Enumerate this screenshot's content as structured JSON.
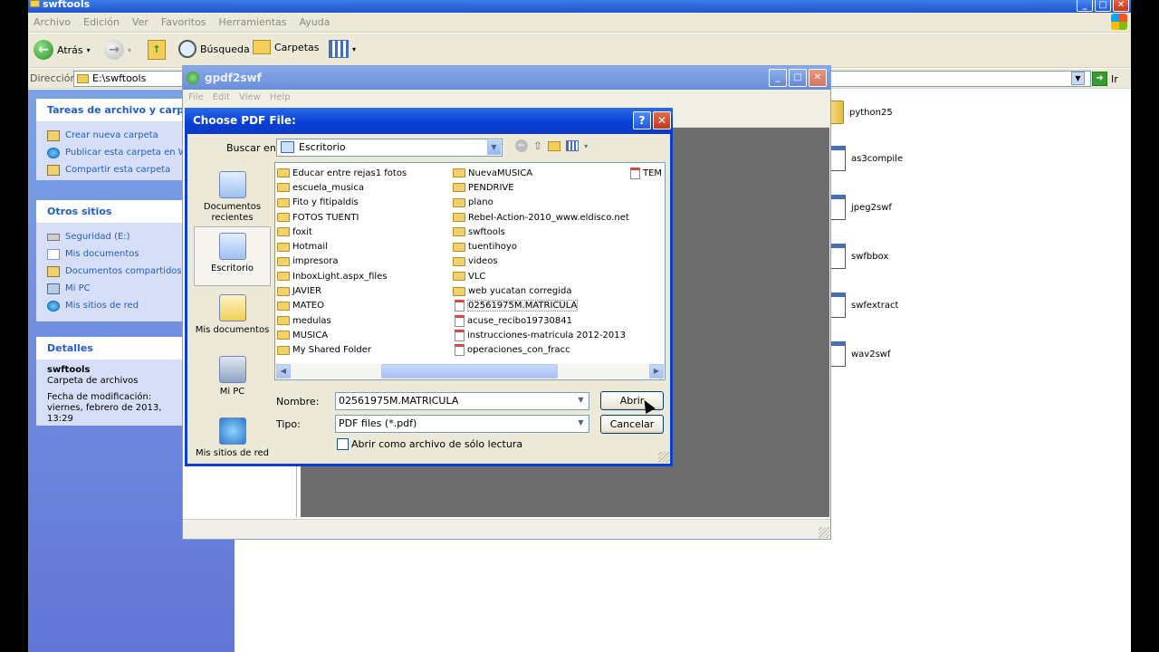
{
  "explorer": {
    "title": "swftools",
    "menu": [
      "Archivo",
      "Edición",
      "Ver",
      "Favoritos",
      "Herramientas",
      "Ayuda"
    ],
    "toolbar": {
      "back": "Atrás",
      "search": "Búsqueda",
      "folders": "Carpetas"
    },
    "address": {
      "label": "Dirección",
      "value": "E:\\swftools",
      "go": "Ir"
    },
    "sidebar": {
      "tasks": {
        "title": "Tareas de archivo y carpeta",
        "items": [
          "Crear nueva carpeta",
          "Publicar esta carpeta en Web",
          "Compartir esta carpeta"
        ]
      },
      "other": {
        "title": "Otros sitios",
        "items": [
          "Seguridad (E:)",
          "Mis documentos",
          "Documentos compartidos",
          "Mi PC",
          "Mis sitios de red"
        ]
      },
      "details": {
        "title": "Detalles",
        "name": "swftools",
        "type": "Carpeta de archivos",
        "modified": "Fecha de modificación: viernes, febrero de 2013, 13:29"
      }
    },
    "files": [
      "python25",
      "as3compile",
      "jpeg2swf",
      "swfbbox",
      "swfextract",
      "wav2swf"
    ]
  },
  "gpdf2swf": {
    "title": "gpdf2swf",
    "menu": [
      "File",
      "Edit",
      "View",
      "Help"
    ]
  },
  "dialog": {
    "title": "Choose PDF File:",
    "help": "?",
    "close": "✕",
    "look_in_label": "Buscar en:",
    "look_in_value": "Escritorio",
    "places": [
      "Documentos recientes",
      "Escritorio",
      "Mis documentos",
      "Mi PC",
      "Mis sitios de red"
    ],
    "col1": [
      "Educar entre rejas1 fotos",
      "escuela_musica",
      "Fito y fitipaldis",
      "FOTOS TUENTI",
      "foxit",
      "Hotmail",
      "impresora",
      "InboxLight.aspx_files",
      "JAVIER",
      "MATEO",
      "medulas",
      "MUSICA",
      "My Shared Folder"
    ],
    "col2_folders": [
      "NuevaMUSICA",
      "PENDRIVE",
      "plano",
      "Rebel-Action-2010_www.eldisco.net",
      "swftools",
      "tuentihoyo",
      "videos",
      "VLC",
      "web yucatan corregida"
    ],
    "col2_files": [
      "02561975M.MATRICULA",
      "acuse_recibo19730841",
      "instrucciones-matricula 2012-2013",
      "operaciones_con_fracc"
    ],
    "col3": [
      "TEM"
    ],
    "name_label": "Nombre:",
    "name_value": "02561975M.MATRICULA",
    "type_label": "Tipo:",
    "type_value": "PDF files (*.pdf)",
    "readonly_label": "Abrir como archivo de sólo lectura",
    "open_button": "Abrir",
    "cancel_button": "Cancelar"
  }
}
